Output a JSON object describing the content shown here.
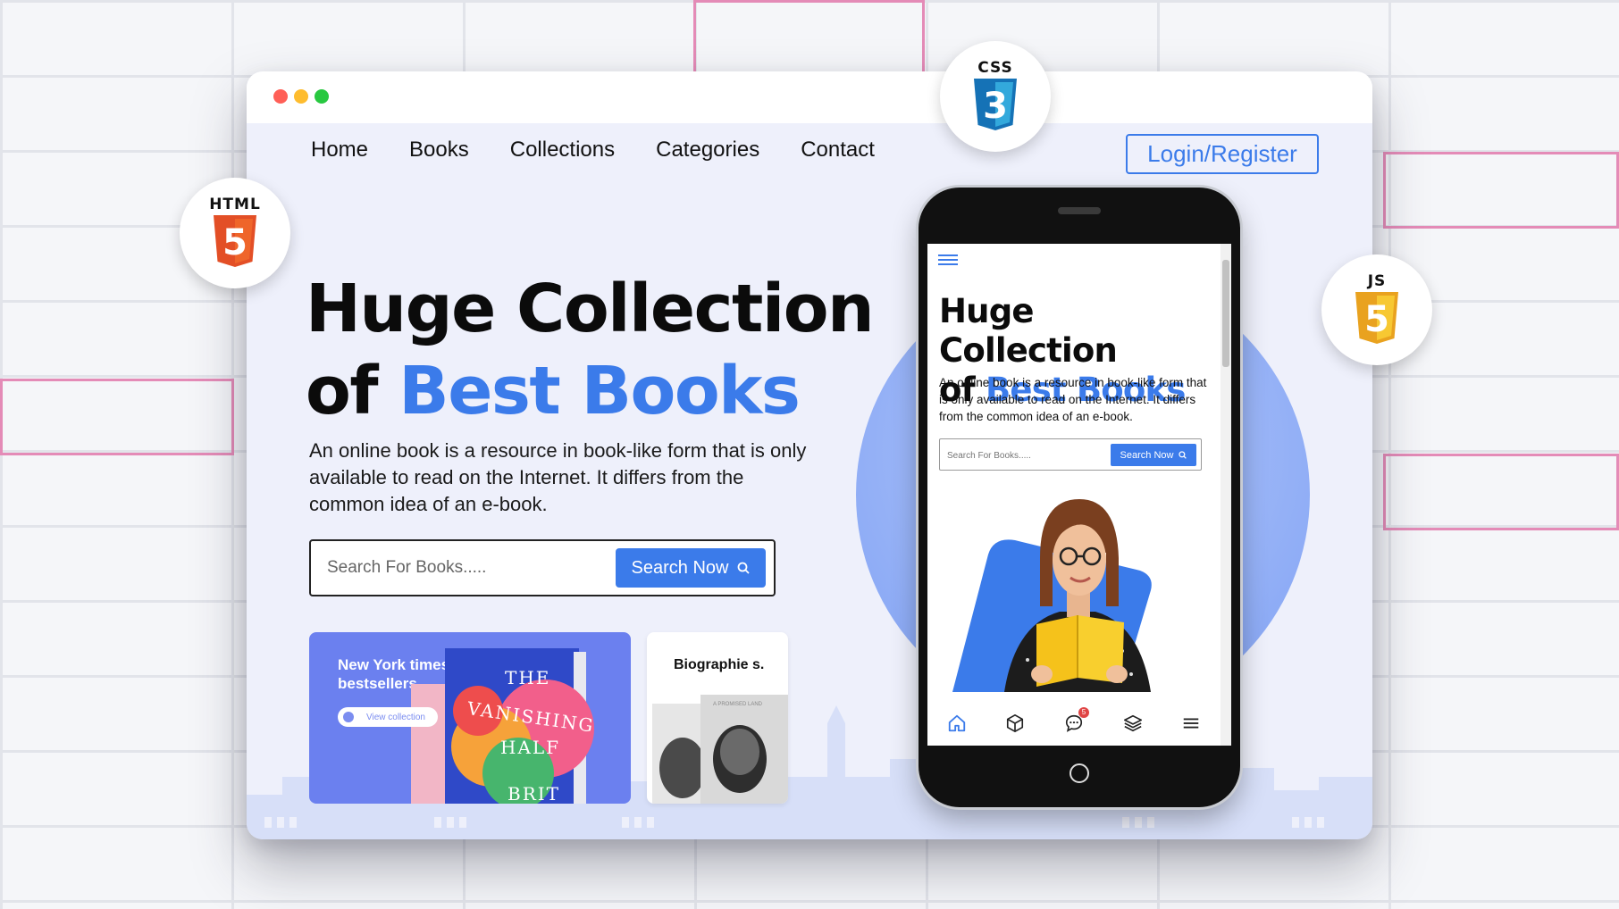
{
  "nav": {
    "items": [
      "Home",
      "Books",
      "Collections",
      "Categories",
      "Contact"
    ],
    "login_label": "Login/Register"
  },
  "hero": {
    "title_line1": "Huge Collection",
    "title_line2_prefix": "of ",
    "title_line2_highlight": "Best Books",
    "description": "An online book is a resource in book-like form that is only available to read on the Internet. It differs from the common idea of an e-book."
  },
  "search": {
    "placeholder": "Search For Books.....",
    "button_label": "Search Now"
  },
  "cards": {
    "nyt": {
      "label": "New York times bestsellers",
      "pill_label": "View collection",
      "book_title_1": "THE",
      "book_title_2": "VANISHING",
      "book_title_3": "HALF",
      "book_author": "BRIT"
    },
    "bio": {
      "label": "Biographie s.",
      "book_label": "A PROMISED LAND"
    }
  },
  "mobile": {
    "title_line1": "Huge Collection",
    "title_line2_prefix": "of ",
    "title_line2_highlight": "Best Books",
    "description": "An online book is a resource in book-like form that is only available to read on the Internet. It differs from the common idea of an e-book.",
    "search_placeholder": "Search For Books.....",
    "search_button_label": "Search Now",
    "bottom_nav": [
      "home-icon",
      "box-icon",
      "chat-icon",
      "layers-icon",
      "menu-icon"
    ],
    "chat_badge": "5"
  },
  "tech_badges": {
    "css": "CSS",
    "css_num": "3",
    "html": "HTML",
    "html_num": "5",
    "js": "JS",
    "js_num": "5"
  },
  "colors": {
    "accent": "#3b7bea",
    "card_blue": "#6b80ef",
    "background": "#eef0fb"
  }
}
